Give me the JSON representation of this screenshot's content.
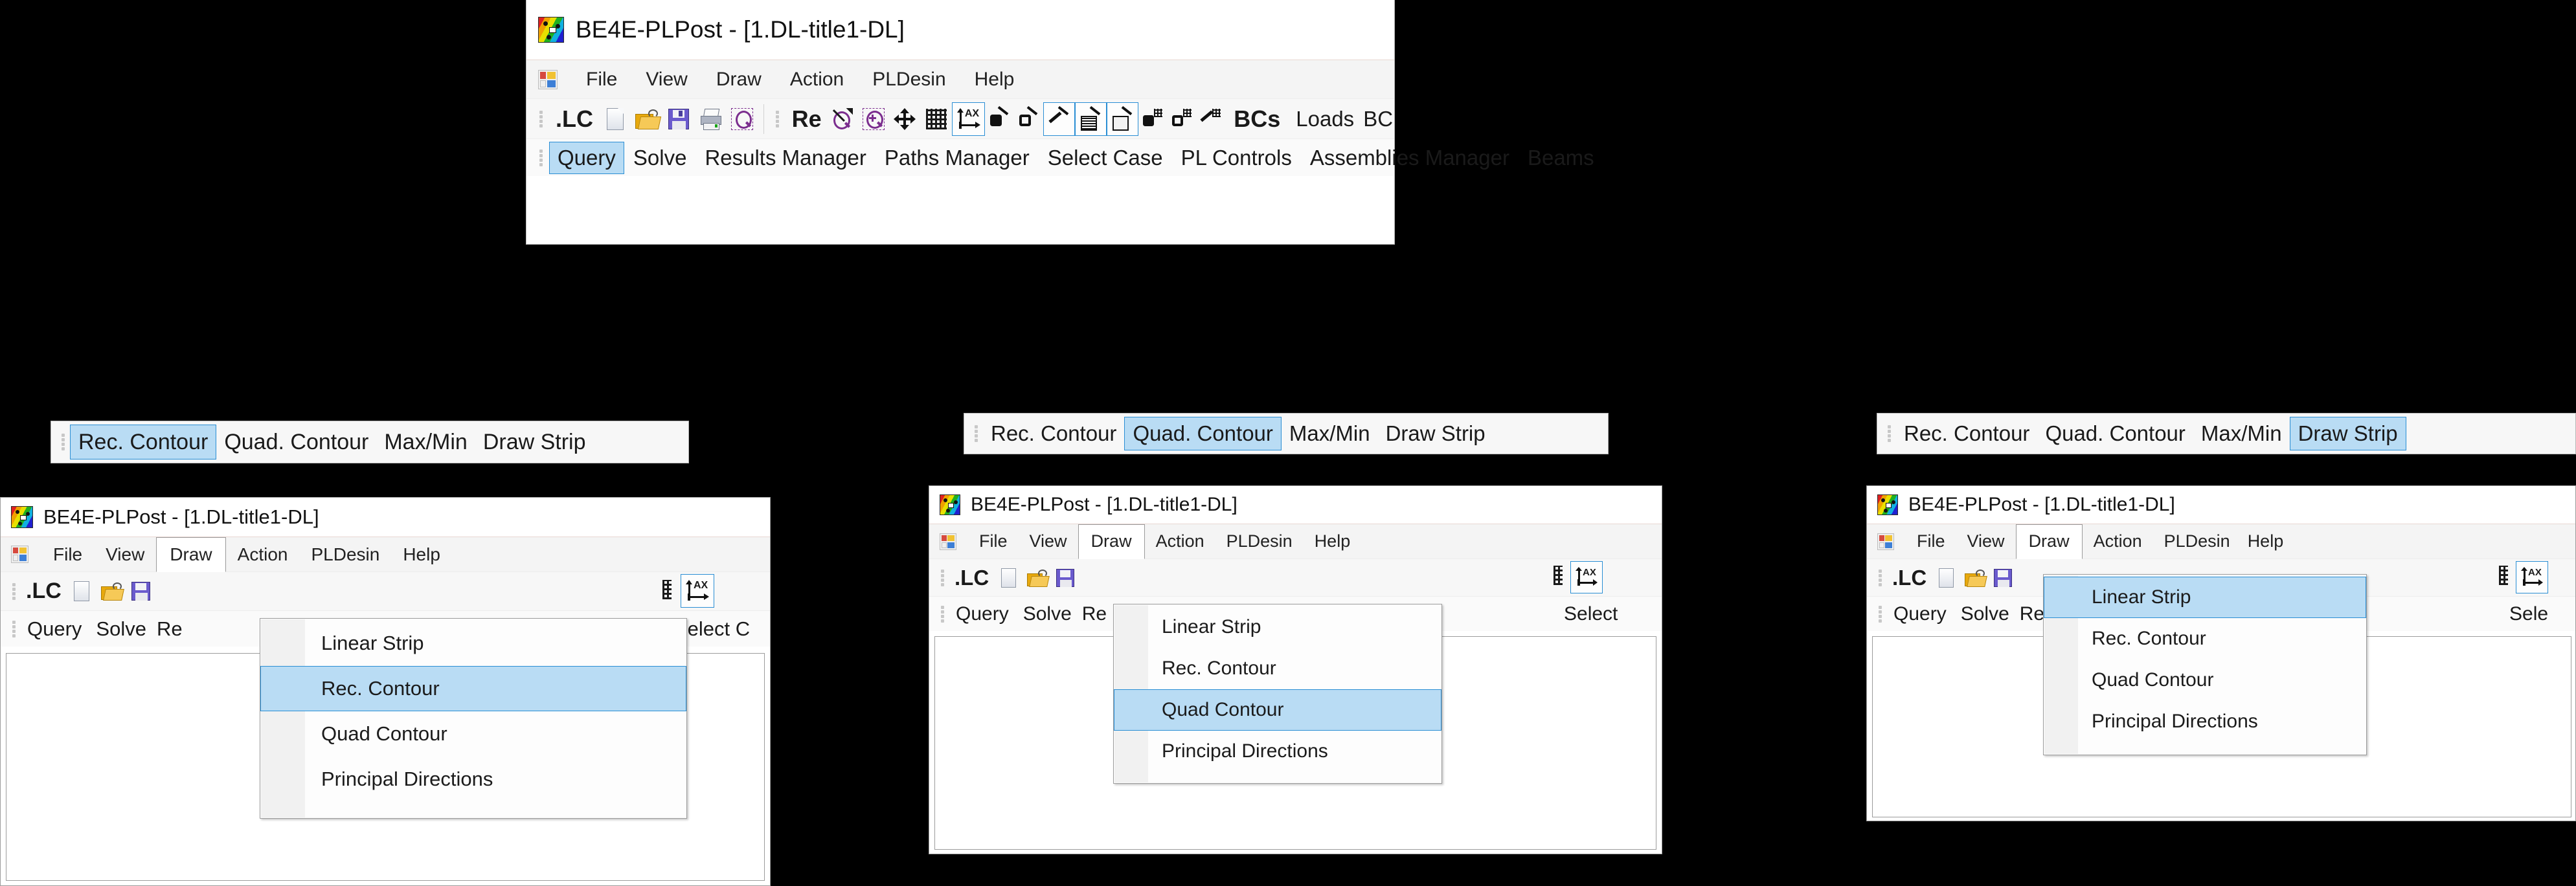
{
  "app": {
    "title": "BE4E-PLPost - [1.DL-title1-DL]",
    "logo_icon": "rainbow-contour-app-icon"
  },
  "menu": {
    "app_glyph_icon": "office-menu-icon",
    "items": [
      "File",
      "View",
      "Draw",
      "Action",
      "PLDesin",
      "Help"
    ]
  },
  "draw_menu": {
    "items": [
      "Linear Strip",
      "Rec. Contour",
      "Quad Contour",
      "Principal Directions"
    ]
  },
  "top_window": {
    "toolbar_main": [
      {
        "label": ".LC",
        "icon": "lc-text-icon",
        "type": "text"
      },
      {
        "label": "",
        "icon": "new-document-icon",
        "type": "icon"
      },
      {
        "label": "",
        "icon": "open-folder-icon",
        "type": "icon"
      },
      {
        "label": "",
        "icon": "save-floppy-icon",
        "type": "icon"
      },
      {
        "label": "",
        "icon": "print-icon",
        "type": "icon"
      },
      {
        "label": "",
        "icon": "print-preview-magnifier-icon",
        "type": "icon"
      },
      {
        "label": "Re",
        "icon": "re-text-icon",
        "type": "text"
      },
      {
        "label": "",
        "icon": "zoom-out-slash-icon",
        "type": "icon"
      },
      {
        "label": "",
        "icon": "zoom-in-icon",
        "type": "icon"
      },
      {
        "label": "",
        "icon": "pan-move-arrows-icon",
        "type": "icon"
      },
      {
        "label": "",
        "icon": "mesh-grid-icon",
        "type": "icon"
      },
      {
        "label": "",
        "icon": "axis-dimension-icon",
        "type": "icon",
        "state": "boxed"
      },
      {
        "label": "",
        "icon": "node-filled-icon",
        "type": "icon"
      },
      {
        "label": "",
        "icon": "node-hollow-icon",
        "type": "icon"
      },
      {
        "label": "",
        "icon": "element-line-icon",
        "type": "icon",
        "state": "boxed"
      },
      {
        "label": "",
        "icon": "contour-fill-icon",
        "type": "icon",
        "state": "boxed"
      },
      {
        "label": "",
        "icon": "contour-outline-icon",
        "type": "icon",
        "state": "boxed"
      },
      {
        "label": "",
        "icon": "node-filled-mesh-icon",
        "type": "icon"
      },
      {
        "label": "",
        "icon": "node-hollow-mesh-icon",
        "type": "icon"
      },
      {
        "label": "",
        "icon": "element-mesh-icon",
        "type": "icon"
      },
      {
        "label": "BCs",
        "icon": "bcs-text-icon",
        "type": "text"
      },
      {
        "label": "Loads",
        "icon": "loads-text-icon",
        "type": "text"
      },
      {
        "label": "BC",
        "icon": "bc-text-icon",
        "type": "text"
      }
    ],
    "toolbar_secondary": [
      {
        "label": "Query",
        "state": "selected"
      },
      {
        "label": "Solve"
      },
      {
        "label": "Results Manager"
      },
      {
        "label": "Paths Manager"
      },
      {
        "label": "Select Case"
      },
      {
        "label": "PL Controls"
      },
      {
        "label": "Assemblies Manager"
      },
      {
        "label": "Beams"
      }
    ]
  },
  "panels": [
    {
      "id": "left",
      "strip_toolbar": {
        "items": [
          "Rec. Contour",
          "Quad. Contour",
          "Max/Min",
          "Draw Strip"
        ],
        "selected": "Rec. Contour"
      },
      "window": {
        "title": "BE4E-PLPost - [1.DL-title1-DL]",
        "open_menu": "Draw",
        "highlighted_item": "Rec. Contour",
        "toolbar_row1_visible": [
          ".LC"
        ],
        "toolbar_row2_visible": [
          "Query",
          "Solve",
          "Re"
        ],
        "right_clipped_label": "Select C"
      }
    },
    {
      "id": "middle",
      "strip_toolbar": {
        "items": [
          "Rec. Contour",
          "Quad. Contour",
          "Max/Min",
          "Draw Strip"
        ],
        "selected": "Quad. Contour"
      },
      "window": {
        "title": "BE4E-PLPost - [1.DL-title1-DL]",
        "open_menu": "Draw",
        "highlighted_item": "Quad Contour",
        "toolbar_row1_visible": [
          ".LC"
        ],
        "toolbar_row2_visible": [
          "Query",
          "Solve",
          "Re"
        ],
        "right_clipped_label": "Select"
      }
    },
    {
      "id": "right",
      "strip_toolbar": {
        "items": [
          "Rec. Contour",
          "Quad. Contour",
          "Max/Min",
          "Draw Strip"
        ],
        "selected": "Draw Strip"
      },
      "window": {
        "title": "BE4E-PLPost - [1.DL-title1-DL]",
        "open_menu": "Draw",
        "highlighted_item": "Linear Strip",
        "toolbar_row1_visible": [
          ".LC"
        ],
        "toolbar_row2_visible": [
          "Query",
          "Solve",
          "Re"
        ],
        "right_clipped_label": "Sele"
      }
    }
  ],
  "colors": {
    "selection_fill": "#b9dcf4",
    "selection_border": "#2a8ed4",
    "window_bg": "#ffffff",
    "toolbar_bg": "#f7f7f7",
    "menubar_bg": "#f4f4f4",
    "backdrop": "#000000"
  }
}
